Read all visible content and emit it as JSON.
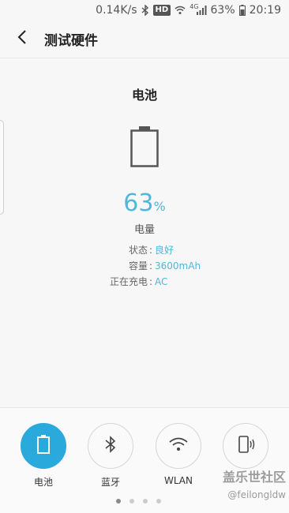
{
  "status_bar": {
    "speed": "0.14K/s",
    "hd": "HD",
    "network": "4G",
    "battery": "63%",
    "time": "20:19"
  },
  "header": {
    "title": "测试硬件"
  },
  "main": {
    "section_title": "电池",
    "percent_value": "63",
    "percent_unit": "%",
    "percent_label": "电量",
    "info": [
      {
        "label": "状态",
        "sep": ":",
        "value": "良好"
      },
      {
        "label": "容量",
        "sep": ":",
        "value": "3600mAh"
      },
      {
        "label": "正在充电",
        "sep": ":",
        "value": "AC"
      }
    ]
  },
  "bottom_tiles": [
    {
      "label": "电池",
      "icon": "battery-icon",
      "active": true
    },
    {
      "label": "蓝牙",
      "icon": "bluetooth-icon",
      "active": false
    },
    {
      "label": "WLAN",
      "icon": "wifi-icon",
      "active": false
    },
    {
      "label": "",
      "icon": "phone-vibrate-icon",
      "active": false
    }
  ],
  "page_indicator": {
    "total": 4,
    "current": 1
  },
  "watermark": {
    "line1": "盖乐世社区",
    "line2": "@feilongldw"
  },
  "colors": {
    "accent": "#4fb8d8",
    "active_tile": "#2aa9dc"
  }
}
